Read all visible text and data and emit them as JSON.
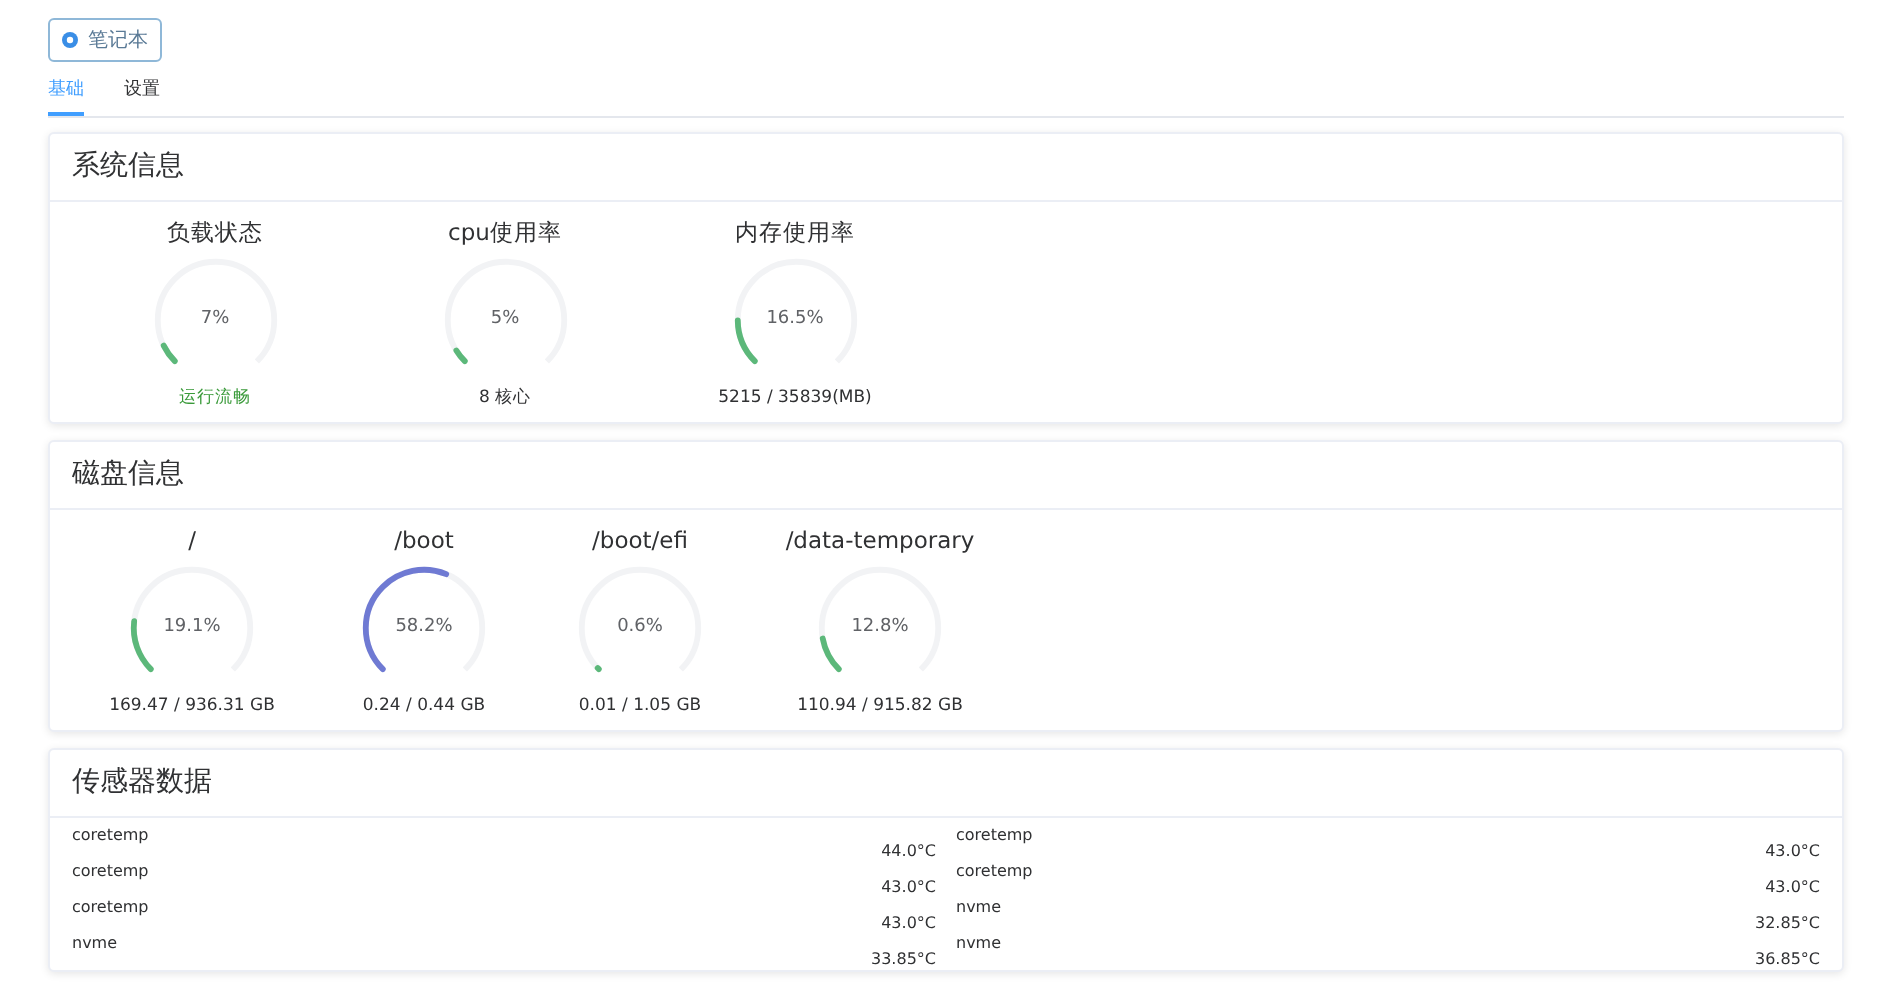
{
  "top_button": {
    "label": "笔记本"
  },
  "tabs": [
    {
      "label": "基础",
      "selected": true
    },
    {
      "label": "设置",
      "selected": false
    }
  ],
  "system_info": {
    "title": "系统信息",
    "gauges": [
      {
        "label": "负载状态",
        "value": "7%",
        "level": 0.07,
        "color": "#5cb87a",
        "caption": "运行流畅",
        "kind": "status"
      },
      {
        "label": "cpu使用率",
        "value": "5%",
        "level": 0.05,
        "color": "#5cb87a",
        "caption": "8 核心",
        "kind": "plain"
      },
      {
        "label": "内存使用率",
        "value": "16.5%",
        "level": 0.165,
        "color": "#5cb87a",
        "caption": "5215 / 35839(MB)",
        "kind": "plain"
      }
    ]
  },
  "disk_info": {
    "title": "磁盘信息",
    "gauges": [
      {
        "label": "/",
        "value": "19.1%",
        "level": 0.191,
        "color": "#5cb87a",
        "caption": "169.47 / 936.31 GB"
      },
      {
        "label": "/boot",
        "value": "58.2%",
        "level": 0.582,
        "color": "#6f7ad3",
        "caption": "0.24 / 0.44 GB"
      },
      {
        "label": "/boot/efi",
        "value": "0.6%",
        "level": 0.006,
        "color": "#5cb87a",
        "caption": "0.01 / 1.05 GB"
      },
      {
        "label": "/data-temporary",
        "value": "12.8%",
        "level": 0.128,
        "color": "#5cb87a",
        "caption": "110.94 / 915.82 GB"
      }
    ]
  },
  "sensor_data": {
    "title": "传感器数据",
    "columns": [
      [
        {
          "name": "coretemp",
          "value": "44.0°C"
        },
        {
          "name": "coretemp",
          "value": "43.0°C"
        },
        {
          "name": "coretemp",
          "value": "43.0°C"
        },
        {
          "name": "nvme",
          "value": "33.85°C"
        }
      ],
      [
        {
          "name": "coretemp",
          "value": "43.0°C"
        },
        {
          "name": "coretemp",
          "value": "43.0°C"
        },
        {
          "name": "nvme",
          "value": "32.85°C"
        },
        {
          "name": "nvme",
          "value": "36.85°C"
        }
      ]
    ]
  }
}
